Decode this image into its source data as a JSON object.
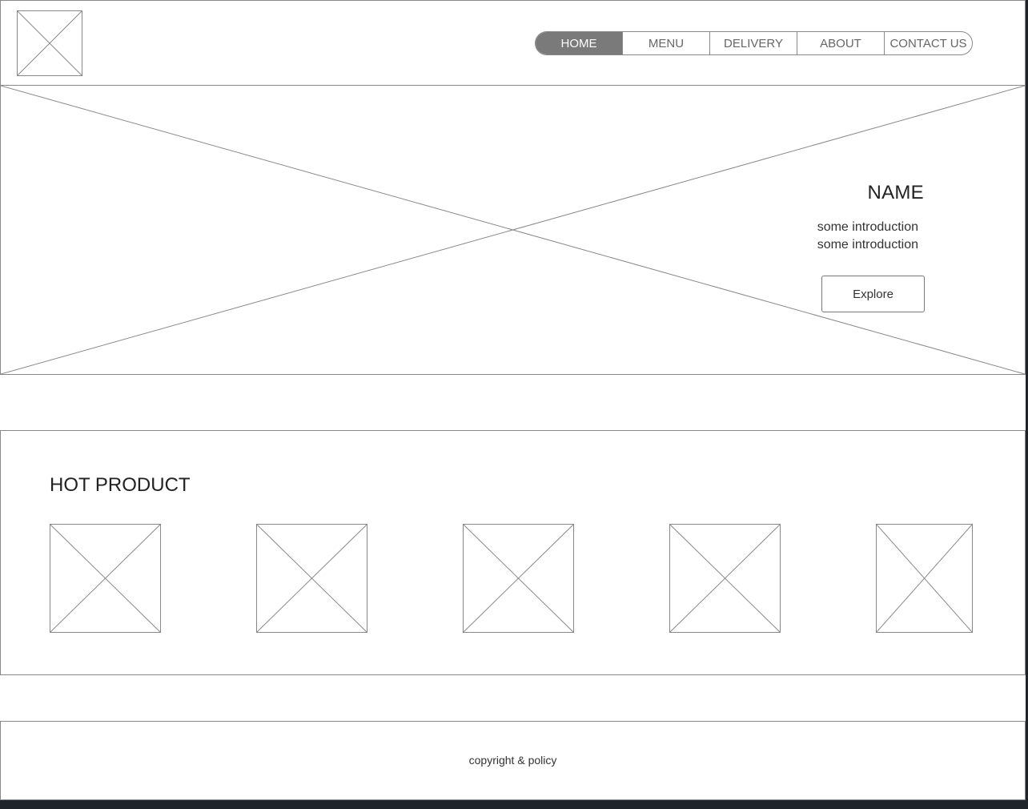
{
  "header": {
    "logo_icon": "image-placeholder-icon",
    "nav": [
      {
        "label": "HOME",
        "active": true
      },
      {
        "label": "MENU",
        "active": false
      },
      {
        "label": "DELIVERY",
        "active": false
      },
      {
        "label": "ABOUT",
        "active": false
      },
      {
        "label": "CONTACT US",
        "active": false
      }
    ]
  },
  "hero": {
    "image_icon": "image-placeholder-icon",
    "title": "NAME",
    "intro_lines": [
      "some introduction",
      "some introduction"
    ],
    "button_label": "Explore"
  },
  "hot_product": {
    "title": "HOT PRODUCT",
    "items": [
      {
        "icon": "image-placeholder-icon"
      },
      {
        "icon": "image-placeholder-icon"
      },
      {
        "icon": "image-placeholder-icon"
      },
      {
        "icon": "image-placeholder-icon"
      },
      {
        "icon": "image-placeholder-icon"
      }
    ]
  },
  "footer": {
    "text": "copyright & policy"
  },
  "colors": {
    "wire": "#888888",
    "active_nav_bg": "#7a7a7a",
    "page_bg": "#ffffff",
    "frame_bg": "#1f242b"
  }
}
